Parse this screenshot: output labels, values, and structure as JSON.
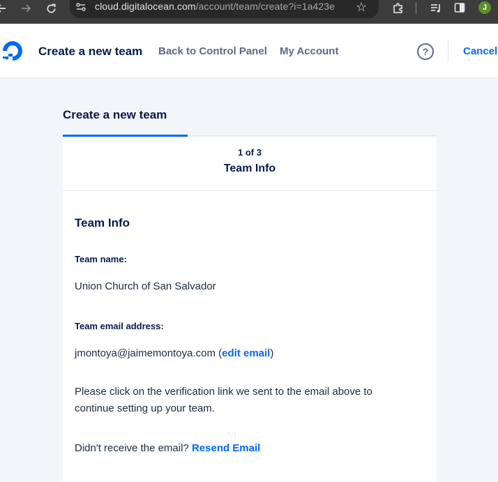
{
  "browser": {
    "url_host": "cloud.digitalocean.com",
    "url_path": "/account/team/create?i=1a423e",
    "profile_initial": "J"
  },
  "header": {
    "title": "Create a new team",
    "back_link": "Back to Control Panel",
    "account_link": "My Account",
    "help_glyph": "?",
    "cancel_label": "Cancel"
  },
  "tabs": [
    {
      "label": "Create a new team"
    }
  ],
  "step": {
    "count": "1 of 3",
    "title": "Team Info"
  },
  "form": {
    "section_title": "Team Info",
    "team_name_label": "Team name:",
    "team_name_value": "Union Church of San Salvador",
    "email_label": "Team email address:",
    "email_value": "jmontoya@jaimemontoya.com",
    "edit_email_open": " (",
    "edit_email_label": "edit email",
    "edit_email_close": ")",
    "verification_text": "Please click on the verification link we sent to the email above to continue setting up your team.",
    "resend_prompt": "Didn't receive the email? ",
    "resend_label": "Resend Email"
  },
  "colors": {
    "brand_blue": "#0069ff",
    "navy": "#031b4e",
    "page_bg": "#f3f5f9"
  },
  "icons": [
    "back-arrow-icon",
    "forward-arrow-icon",
    "reload-icon",
    "site-settings-icon",
    "bookmark-star-icon",
    "extensions-icon",
    "media-control-icon",
    "side-panel-icon",
    "digitalocean-logo-icon",
    "help-icon"
  ]
}
